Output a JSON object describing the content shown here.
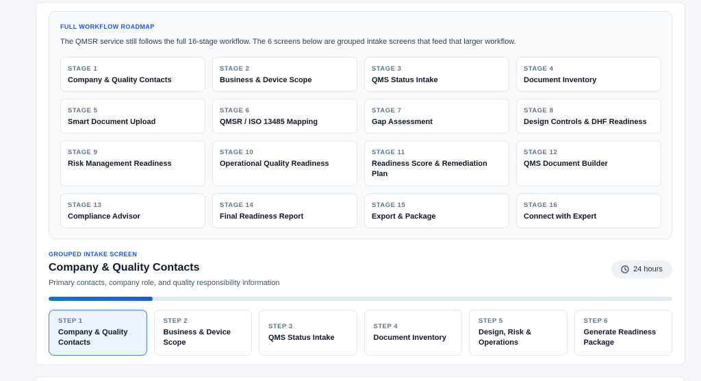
{
  "roadmap": {
    "eyebrow": "FULL WORKFLOW ROADMAP",
    "description": "The QMSR service still follows the full 16-stage workflow. The 6 screens below are grouped intake screens that feed that larger workflow.",
    "stages": [
      {
        "label": "STAGE 1",
        "title": "Company & Quality Contacts"
      },
      {
        "label": "STAGE 2",
        "title": "Business & Device Scope"
      },
      {
        "label": "STAGE 3",
        "title": "QMS Status Intake"
      },
      {
        "label": "STAGE 4",
        "title": "Document Inventory"
      },
      {
        "label": "STAGE 5",
        "title": "Smart Document Upload"
      },
      {
        "label": "STAGE 6",
        "title": "QMSR / ISO 13485 Mapping"
      },
      {
        "label": "STAGE 7",
        "title": "Gap Assessment"
      },
      {
        "label": "STAGE 8",
        "title": "Design Controls & DHF Readiness"
      },
      {
        "label": "STAGE 9",
        "title": "Risk Management Readiness"
      },
      {
        "label": "STAGE 10",
        "title": "Operational Quality Readiness"
      },
      {
        "label": "STAGE 11",
        "title": "Readiness Score & Remediation Plan"
      },
      {
        "label": "STAGE 12",
        "title": "QMS Document Builder"
      },
      {
        "label": "STAGE 13",
        "title": "Compliance Advisor"
      },
      {
        "label": "STAGE 14",
        "title": "Final Readiness Report"
      },
      {
        "label": "STAGE 15",
        "title": "Export & Package"
      },
      {
        "label": "STAGE 16",
        "title": "Connect with Expert"
      }
    ]
  },
  "intake": {
    "eyebrow": "GROUPED INTAKE SCREEN",
    "title": "Company & Quality Contacts",
    "description": "Primary contacts, company role, and quality responsibility information",
    "time_badge": "24 hours",
    "time_icon": "clock-icon",
    "progress_fraction": 0.1667,
    "accent_color": "#1e5bd6",
    "steps": [
      {
        "label": "STEP 1",
        "title": "Company & Quality Contacts",
        "active": true
      },
      {
        "label": "STEP 2",
        "title": "Business & Device Scope",
        "active": false
      },
      {
        "label": "STEP 3",
        "title": "QMS Status Intake",
        "active": false
      },
      {
        "label": "STEP 4",
        "title": "Document Inventory",
        "active": false
      },
      {
        "label": "STEP 5",
        "title": "Design, Risk & Operations",
        "active": false
      },
      {
        "label": "STEP 6",
        "title": "Generate Readiness Package",
        "active": false
      }
    ]
  }
}
